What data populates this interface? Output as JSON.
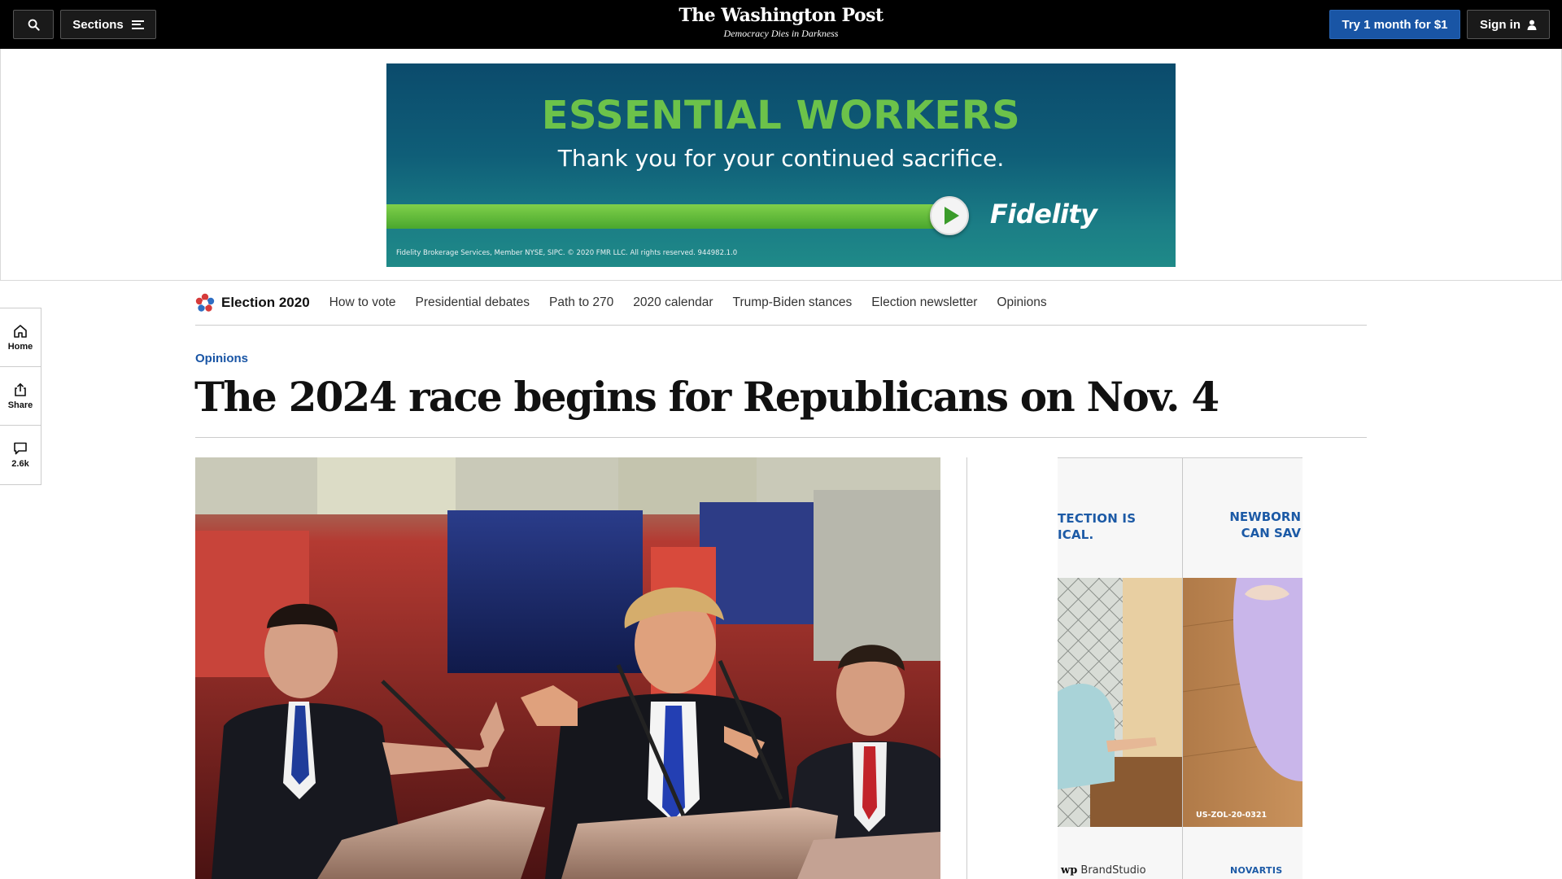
{
  "header": {
    "sections_label": "Sections",
    "logo": "The Washington Post",
    "tagline": "Democracy Dies in Darkness",
    "subscribe_label": "Try 1 month for $1",
    "signin_label": "Sign in",
    "subscribe_color": "#1955a5"
  },
  "top_ad": {
    "headline": "ESSENTIAL WORKERS",
    "subline": "Thank you for your continued sacrifice.",
    "brand": "Fidelity",
    "legal": "Fidelity Brokerage Services, Member NYSE, SIPC. © 2020 FMR LLC. All rights reserved. 944982.1.0"
  },
  "side_rail": {
    "home_label": "Home",
    "share_label": "Share",
    "comments_count": "2.6k"
  },
  "election_nav": {
    "title": "Election 2020",
    "links": [
      "How to vote",
      "Presidential debates",
      "Path to 270",
      "2020 calendar",
      "Trump-Biden stances",
      "Election newsletter",
      "Opinions"
    ]
  },
  "article": {
    "kicker": "Opinions",
    "headline": "The 2024 race begins for Republicans on Nov. 4"
  },
  "rail_ad": {
    "text_left_1": "TECTION IS",
    "text_left_2": "ICAL.",
    "text_right_1": "NEWBORN",
    "text_right_2": "CAN SAV",
    "code": "US-ZOL-20-0321",
    "brandstudio": "BrandStudio",
    "sponsor": "NOVARTIS"
  }
}
